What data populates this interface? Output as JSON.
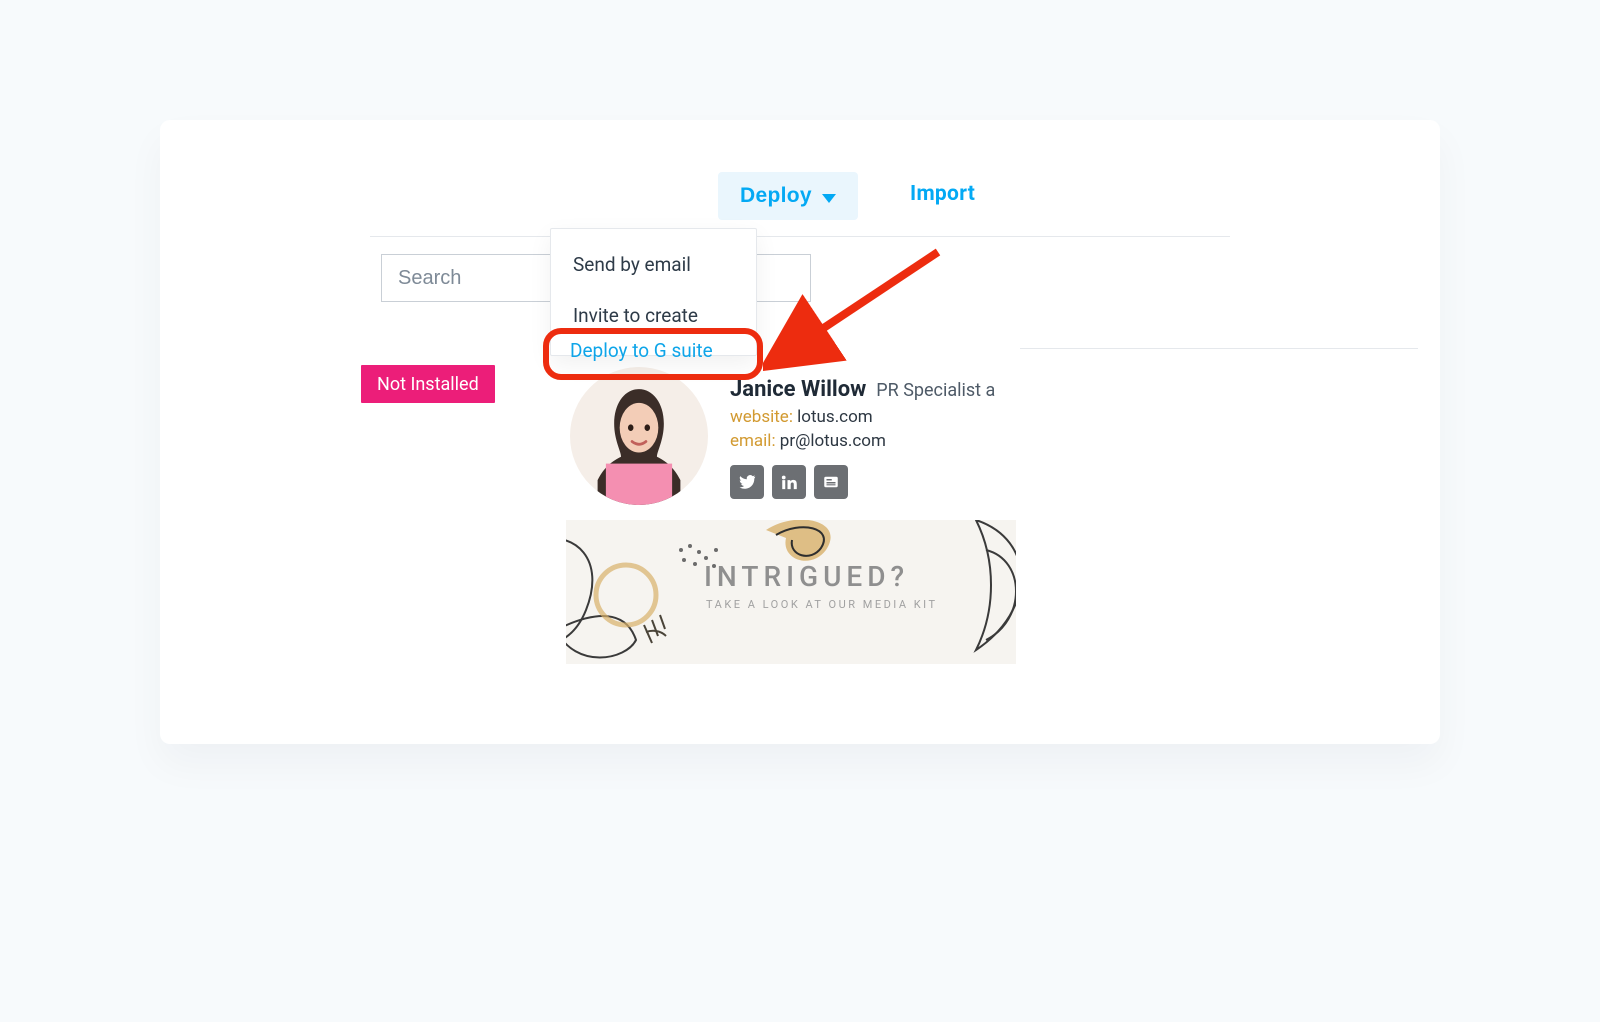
{
  "toolbar": {
    "deploy_label": "Deploy",
    "import_label": "Import"
  },
  "search": {
    "placeholder": "Search",
    "value": ""
  },
  "deploy_menu": {
    "send_by_email": "Send by email",
    "invite_to_create": "Invite to create",
    "deploy_to_gsuite": "Deploy to G suite"
  },
  "status": {
    "not_installed": "Not Installed"
  },
  "signature": {
    "name": "Janice Willow",
    "title": "PR Specialist a",
    "website_label": "website:",
    "website_value": "lotus.com",
    "email_label": "email:",
    "email_value": "pr@lotus.com",
    "social": {
      "twitter": "twitter-icon",
      "linkedin": "linkedin-icon",
      "gnews": "google-news-icon"
    },
    "banner": {
      "title": "INTRIGUED?",
      "subtitle": "TAKE A LOOK AT OUR MEDIA KIT"
    }
  },
  "colors": {
    "accent": "#03a9f4",
    "badge": "#ec1e79",
    "highlight": "#ed2c0f"
  }
}
